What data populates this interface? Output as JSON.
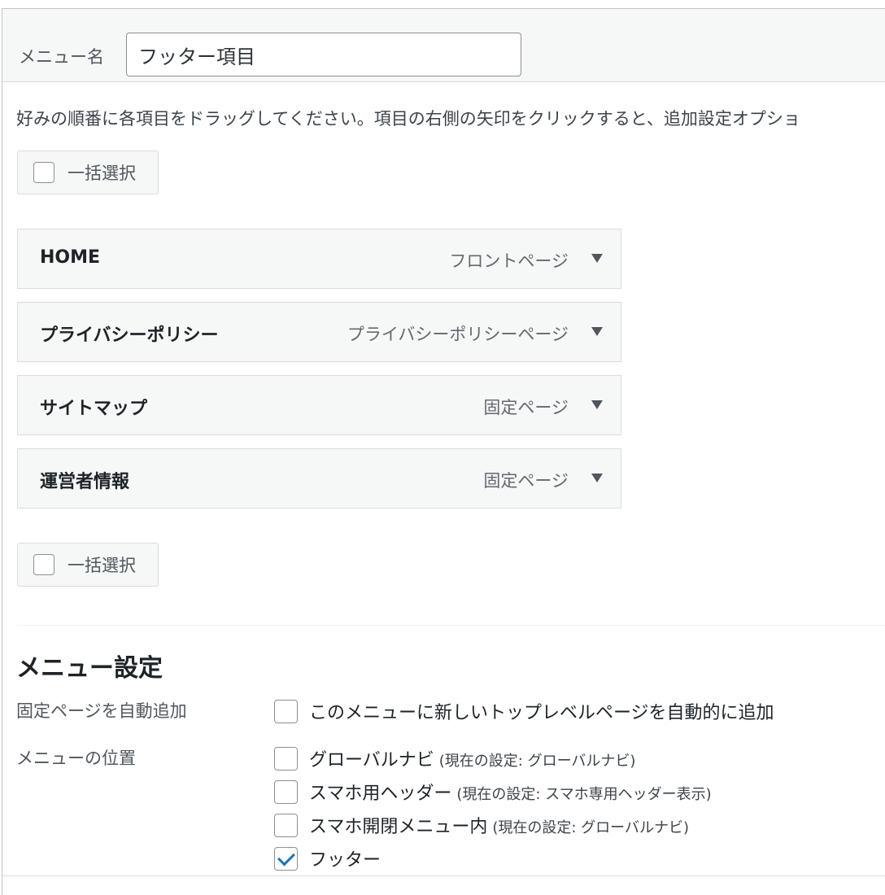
{
  "menu_name": {
    "label": "メニュー名",
    "value": "フッター項目"
  },
  "instructions": "好みの順番に各項目をドラッグしてください。項目の右側の矢印をクリックすると、追加設定オプショ",
  "bulk_select": {
    "label": "一括選択"
  },
  "menu_items": [
    {
      "title": "HOME",
      "type": "フロントページ"
    },
    {
      "title": "プライバシーポリシー",
      "type": "プライバシーポリシーページ"
    },
    {
      "title": "サイトマップ",
      "type": "固定ページ"
    },
    {
      "title": "運営者情報",
      "type": "固定ページ"
    }
  ],
  "menu_settings": {
    "heading": "メニュー設定",
    "auto_add": {
      "label": "固定ページを自動追加",
      "option": "このメニューに新しいトップレベルページを自動的に追加",
      "checked": false
    },
    "locations": {
      "label": "メニューの位置",
      "options": [
        {
          "name": "グローバルナビ",
          "note": "(現在の設定: グローバルナビ)",
          "checked": false
        },
        {
          "name": "スマホ用ヘッダー",
          "note": "(現在の設定: スマホ専用ヘッダー表示)",
          "checked": false
        },
        {
          "name": "スマホ開閉メニュー内",
          "note": "(現在の設定: グローバルナビ)",
          "checked": false
        },
        {
          "name": "フッター",
          "note": "",
          "checked": true
        }
      ]
    }
  },
  "colors": {
    "accent": "#2271b1",
    "panel_bg": "#f6f7f7",
    "border": "#dcdcde"
  }
}
